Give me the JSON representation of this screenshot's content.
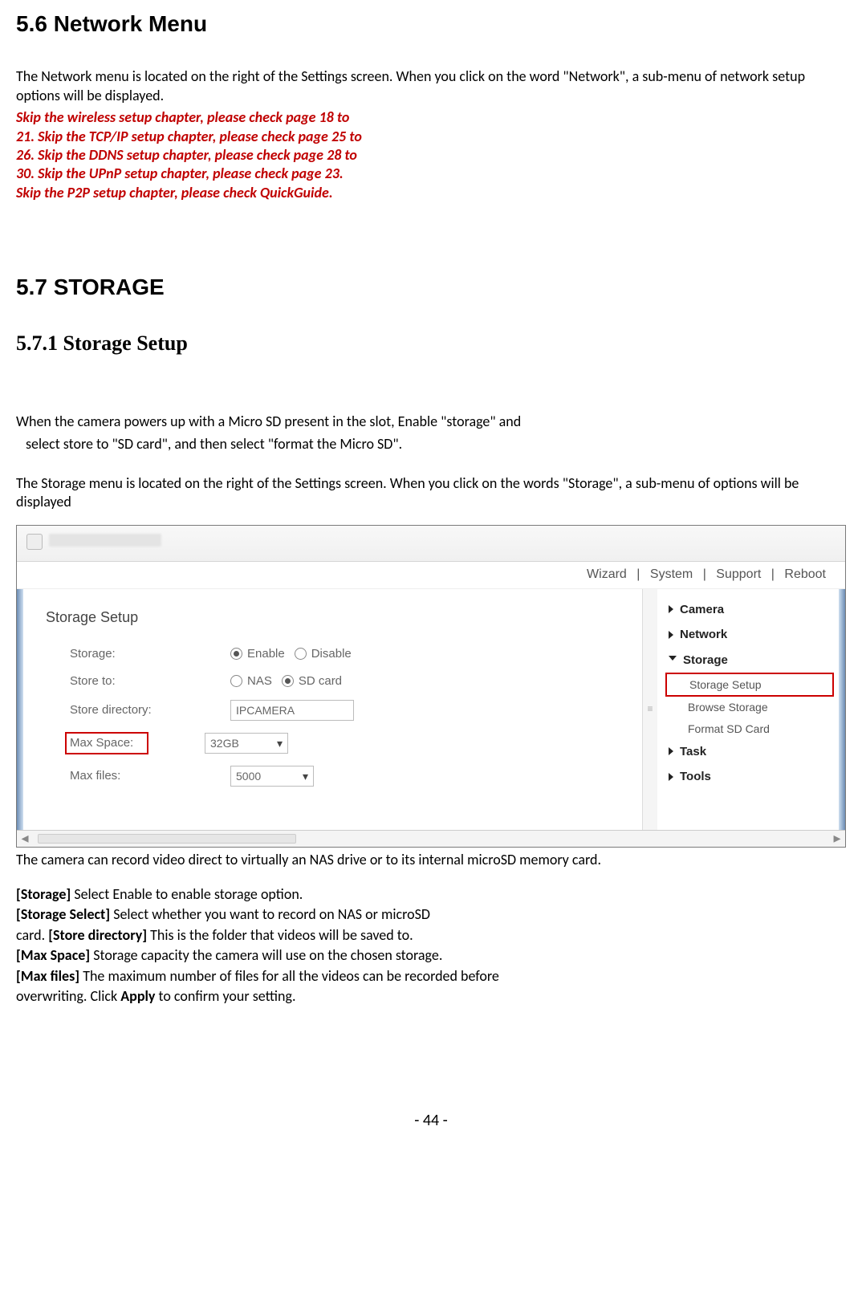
{
  "headings": {
    "h56": "5.6 Network Menu",
    "h57": "5.7 STORAGE",
    "h571": "5.7.1 Storage Setup"
  },
  "paras": {
    "net_intro": "The Network menu is located on the right of the Settings screen. When you click on the word \"Network\", a sub-menu of network setup options will be displayed.",
    "red1": "Skip the wireless setup chapter, please check page 18 to",
    "red2": "21. Skip the TCP/IP setup chapter, please check page 25 to",
    "red3": "26. Skip the DDNS setup chapter, please check page 28 to",
    "red4": "30. Skip the UPnP setup chapter, please check page 23.",
    "red5": "Skip the P2P setup chapter, please check QuickGuide.",
    "stor_p1a": "When the camera powers up with a Micro SD present in the slot, Enable \"storage\" and",
    "stor_p1b": "select store to \"SD card\", and then select \"format the Micro SD\".",
    "stor_p2": "The Storage menu is located on the right of the Settings screen. When you click on the words \"Storage\", a sub-menu of options will be displayed",
    "after_img": "The camera can record video direct to virtually an NAS drive or to its internal microSD memory card."
  },
  "defs": {
    "d1_b": "[Storage] ",
    "d1_t": "Select Enable to enable storage option.",
    "d2_b": "[Storage Select] ",
    "d2_t": "Select whether you want to record on NAS or microSD",
    "d3_pre": "card. ",
    "d3_b": "[Store directory] ",
    "d3_t": "This is the folder that videos will be saved to.",
    "d4_b": "[Max Space] ",
    "d4_t": "Storage capacity the camera will use on the chosen storage.",
    "d5_b": "[Max files] ",
    "d5_t": "The maximum number of files for all the videos can be recorded before",
    "d6_pre": "overwriting. Click ",
    "d6_b": "Apply",
    "d6_t": " to confirm your setting."
  },
  "ui": {
    "topnav": {
      "wizard": "Wizard",
      "system": "System",
      "support": "Support",
      "reboot": "Reboot",
      "sep": "|"
    },
    "panel_title": "Storage Setup",
    "labels": {
      "storage": "Storage:",
      "storeto": "Store to:",
      "storedir": "Store directory:",
      "maxspace": "Max Space:",
      "maxfiles": "Max files:"
    },
    "options": {
      "enable": "Enable",
      "disable": "Disable",
      "nas": "NAS",
      "sdcard": "SD card"
    },
    "values": {
      "storedir": "IPCAMERA",
      "maxspace": "32GB",
      "maxfiles": "5000"
    },
    "sidemenu": {
      "camera": "Camera",
      "network": "Network",
      "storage": "Storage",
      "storage_setup": "Storage Setup",
      "browse": "Browse Storage",
      "format": "Format SD Card",
      "task": "Task",
      "tools": "Tools"
    }
  },
  "footer": {
    "page": "- 44 -"
  }
}
